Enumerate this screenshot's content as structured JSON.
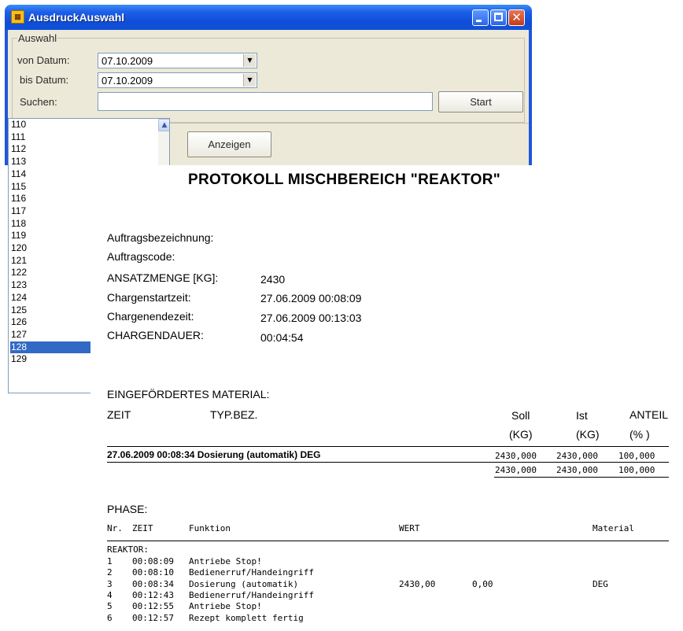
{
  "window": {
    "title": "AusdruckAuswahl",
    "groupbox_label": "Auswahl",
    "von_label": "von Datum:",
    "von_value": "07.10.2009",
    "bis_label": "bis Datum:",
    "bis_value": "07.10.2009",
    "suchen_label": "Suchen:",
    "suchen_value": "",
    "start_label": "Start",
    "anzeigen_label": "Anzeigen",
    "list_items": [
      "110",
      "111",
      "112",
      "113",
      "114",
      "115",
      "116",
      "117",
      "118",
      "119",
      "120",
      "121",
      "122",
      "123",
      "124",
      "125",
      "126",
      "127",
      "128",
      "129"
    ],
    "selected_item": "128",
    "colors": {
      "titlebar": "#1c5ee7",
      "selection": "#316ac5",
      "client": "#ece9d8"
    }
  },
  "report": {
    "title": "PROTOKOLL MISCHBEREICH \"REAKTOR\"",
    "fields": [
      {
        "label": "Auftragsbezeichnung:",
        "value": ""
      },
      {
        "label": "Auftragscode:",
        "value": ""
      },
      {
        "label": "ANSATZMENGE [KG]:",
        "value": "2430"
      },
      {
        "label": "Chargenstartzeit:",
        "value": "27.06.2009 00:08:09"
      },
      {
        "label": "Chargenendezeit:",
        "value": "27.06.2009 00:13:03"
      },
      {
        "label": "CHARGENDAUER:",
        "value": "00:04:54"
      }
    ],
    "material": {
      "heading": "EINGEFÖRDERTES MATERIAL:",
      "col_zeit": "ZEIT",
      "col_typ": "TYP.BEZ.",
      "col_soll": "Soll",
      "col_ist": "Ist",
      "col_anteil": "ANTEIL",
      "unit_soll": "(KG)",
      "unit_ist": "(KG)",
      "unit_anteil": "(% )",
      "row": {
        "text": "27.06.2009 00:08:34  Dosierung (automatik)   DEG",
        "soll": "2430,000",
        "ist": "2430,000",
        "anteil": "100,000"
      },
      "total": {
        "soll": "2430,000",
        "ist": "2430,000",
        "anteil": "100,000"
      }
    },
    "phase": {
      "heading": "PHASE:",
      "col_nr": "Nr.",
      "col_zeit": "ZEIT",
      "col_funktion": "Funktion",
      "col_wert": "WERT",
      "col_material": "Material",
      "group_label": "REAKTOR:",
      "rows": [
        {
          "nr": "1",
          "zeit": "00:08:09",
          "funktion": "Antriebe Stop!",
          "wert": "",
          "wert2": "",
          "material": ""
        },
        {
          "nr": "2",
          "zeit": "00:08:10",
          "funktion": "Bedienerruf/Handeingriff",
          "wert": "",
          "wert2": "",
          "material": ""
        },
        {
          "nr": "3",
          "zeit": "00:08:34",
          "funktion": "Dosierung (automatik)",
          "wert": "2430,00",
          "wert2": "0,00",
          "material": "DEG"
        },
        {
          "nr": "4",
          "zeit": "00:12:43",
          "funktion": "Bedienerruf/Handeingriff",
          "wert": "",
          "wert2": "",
          "material": ""
        },
        {
          "nr": "5",
          "zeit": "00:12:55",
          "funktion": "Antriebe Stop!",
          "wert": "",
          "wert2": "",
          "material": ""
        },
        {
          "nr": "6",
          "zeit": "00:12:57",
          "funktion": "Rezept komplett fertig",
          "wert": "",
          "wert2": "",
          "material": ""
        }
      ]
    }
  }
}
